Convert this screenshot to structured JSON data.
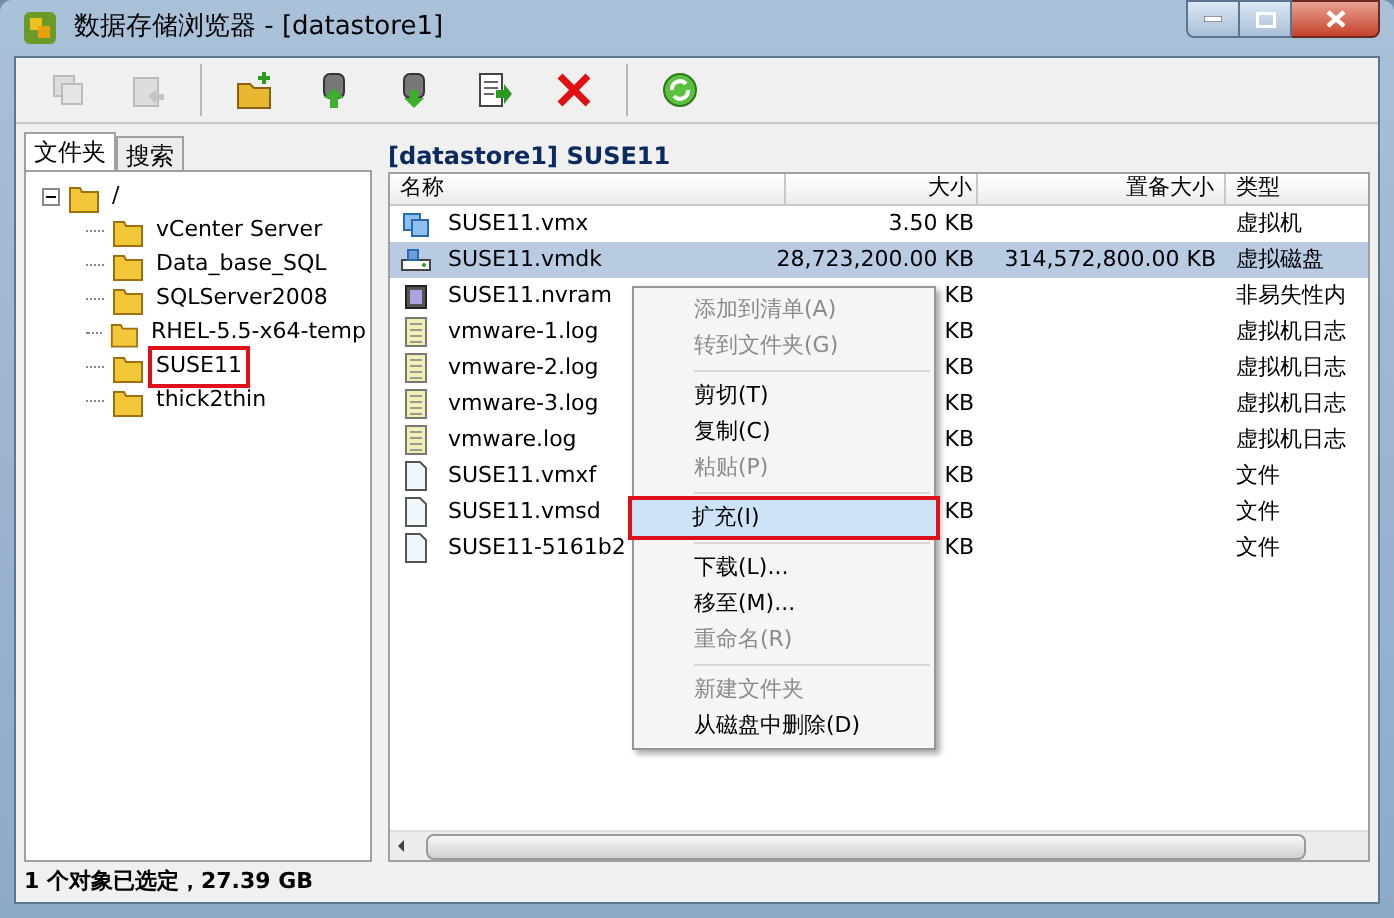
{
  "window": {
    "title": "数据存储浏览器 - [datastore1]"
  },
  "toolbar": [
    {
      "kind": "copy",
      "disabled": true
    },
    {
      "kind": "back",
      "disabled": true
    },
    {
      "kind": "sep"
    },
    {
      "kind": "newfolder",
      "disabled": false
    },
    {
      "kind": "upload",
      "disabled": false
    },
    {
      "kind": "download",
      "disabled": false
    },
    {
      "kind": "move",
      "disabled": false
    },
    {
      "kind": "delete",
      "disabled": false
    },
    {
      "kind": "sep"
    },
    {
      "kind": "refresh",
      "disabled": false
    }
  ],
  "tabs": [
    {
      "label": "文件夹",
      "selected": true
    },
    {
      "label": "搜索",
      "selected": false
    }
  ],
  "tree": [
    {
      "label": "/",
      "expanded": true,
      "annotated": false,
      "children": [
        {
          "label": "vCenter Server",
          "annotated": false
        },
        {
          "label": "Data_base_SQL",
          "annotated": false
        },
        {
          "label": "SQLServer2008",
          "annotated": false
        },
        {
          "label": "RHEL-5.5-x64-temp",
          "annotated": false
        },
        {
          "label": "SUSE11",
          "annotated": true
        },
        {
          "label": "thick2thin",
          "annotated": false
        }
      ]
    }
  ],
  "path": "[datastore1] SUSE11",
  "table": {
    "columns": [
      "名称",
      "大小",
      "置备大小",
      "类型"
    ],
    "rows": [
      {
        "kind": "vm",
        "name": "SUSE11.vmx",
        "size": "3.50 KB",
        "provisioned": "",
        "type": "虚拟机",
        "selected": false
      },
      {
        "kind": "disk",
        "name": "SUSE11.vmdk",
        "size": "28,723,200.00 KB",
        "provisioned": "314,572,800.00 KB",
        "type": "虚拟磁盘",
        "selected": true
      },
      {
        "kind": "nvram",
        "name": "SUSE11.nvram",
        "size": "KB",
        "provisioned": "",
        "type": "非易失性内",
        "selected": false
      },
      {
        "kind": "log",
        "name": "vmware-1.log",
        "size": "KB",
        "provisioned": "",
        "type": "虚拟机日志",
        "selected": false
      },
      {
        "kind": "log",
        "name": "vmware-2.log",
        "size": "KB",
        "provisioned": "",
        "type": "虚拟机日志",
        "selected": false
      },
      {
        "kind": "log",
        "name": "vmware-3.log",
        "size": "KB",
        "provisioned": "",
        "type": "虚拟机日志",
        "selected": false
      },
      {
        "kind": "log",
        "name": "vmware.log",
        "size": "KB",
        "provisioned": "",
        "type": "虚拟机日志",
        "selected": false
      },
      {
        "kind": "file",
        "name": "SUSE11.vmxf",
        "size": "KB",
        "provisioned": "",
        "type": "文件",
        "selected": false
      },
      {
        "kind": "file",
        "name": "SUSE11.vmsd",
        "size": "KB",
        "provisioned": "",
        "type": "文件",
        "selected": false
      },
      {
        "kind": "file",
        "name": "SUSE11-5161b2",
        "size": "KB",
        "provisioned": "",
        "type": "文件",
        "selected": false
      }
    ]
  },
  "context_menu": [
    {
      "kind": "item",
      "label": "添加到清单(A)",
      "disabled": true,
      "highlighted": false
    },
    {
      "kind": "item",
      "label": "转到文件夹(G)",
      "disabled": true,
      "highlighted": false
    },
    {
      "kind": "sep"
    },
    {
      "kind": "item",
      "label": "剪切(T)",
      "disabled": false,
      "highlighted": false
    },
    {
      "kind": "item",
      "label": "复制(C)",
      "disabled": false,
      "highlighted": false
    },
    {
      "kind": "item",
      "label": "粘贴(P)",
      "disabled": true,
      "highlighted": false
    },
    {
      "kind": "sep"
    },
    {
      "kind": "item",
      "label": "扩充(I)",
      "disabled": false,
      "highlighted": true
    },
    {
      "kind": "sep"
    },
    {
      "kind": "item",
      "label": "下载(L)...",
      "disabled": false,
      "highlighted": false
    },
    {
      "kind": "item",
      "label": "移至(M)...",
      "disabled": false,
      "highlighted": false
    },
    {
      "kind": "item",
      "label": "重命名(R)",
      "disabled": true,
      "highlighted": false
    },
    {
      "kind": "sep"
    },
    {
      "kind": "item",
      "label": "新建文件夹",
      "disabled": true,
      "highlighted": false
    },
    {
      "kind": "item",
      "label": "从磁盘中删除(D)",
      "disabled": false,
      "highlighted": false
    }
  ],
  "status_bar": "1 个对象已选定，27.39 GB"
}
